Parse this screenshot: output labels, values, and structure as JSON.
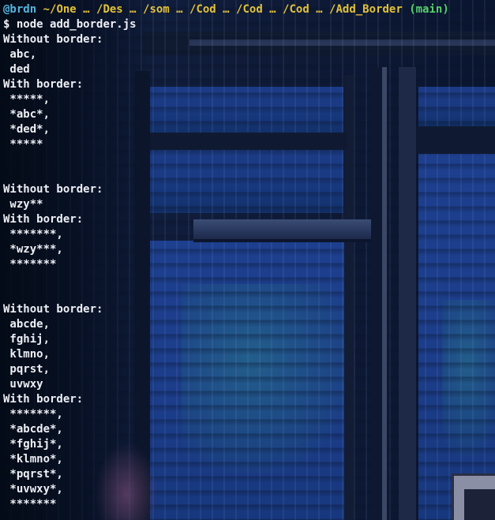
{
  "prompt": {
    "user": "@brdn",
    "path": "~/One … /Des … /som … /Cod … /Cod … /Cod … /Add_Border",
    "branch": "(main)"
  },
  "command": {
    "symbol": "$",
    "text": "node add_border.js"
  },
  "output_lines": [
    "Without border:",
    " abc,",
    " ded",
    "With border:",
    " *****,",
    " *abc*,",
    " *ded*,",
    " *****",
    "",
    "",
    "Without border:",
    " wzy**",
    "With border:",
    " *******,",
    " *wzy***,",
    " *******",
    "",
    "",
    "Without border:",
    " abcde,",
    " fghij,",
    " klmno,",
    " pqrst,",
    " uvwxy",
    "With border:",
    " *******,",
    " *abcde*,",
    " *fghij*,",
    " *klmno*,",
    " *pqrst*,",
    " *uvwxy*,",
    " *******"
  ],
  "colors": {
    "user": "#57b4de",
    "path": "#e3c23a",
    "branch": "#55d16a",
    "text": "#eef0f6",
    "background": "#0b1326"
  }
}
